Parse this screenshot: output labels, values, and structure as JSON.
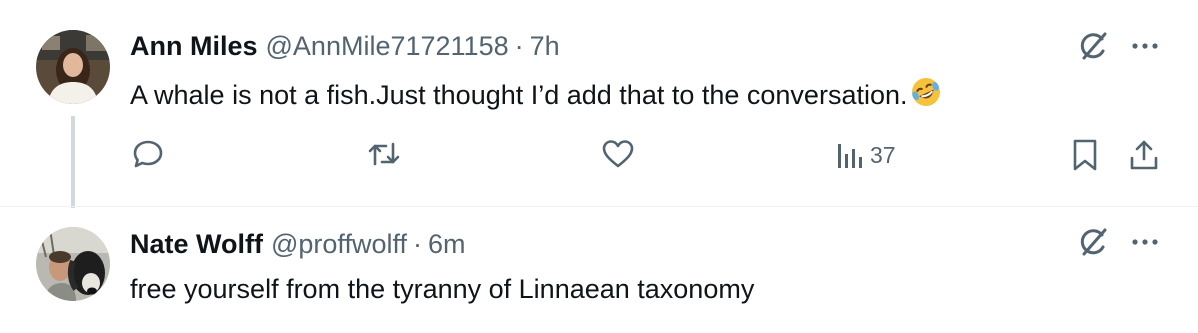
{
  "tweets": [
    {
      "name": "Ann Miles",
      "handle": "@AnnMile71721158",
      "separator": "·",
      "time": "7h",
      "text": "A whale is not a fish.Just thought I’d add that to the conversation.",
      "emoji": "rolling-on-floor-laughing",
      "views": "37"
    },
    {
      "name": "Nate Wolff",
      "handle": "@proffwolff",
      "separator": "·",
      "time": "6m",
      "text": "free yourself from the tyranny of Linnaean taxonomy"
    }
  ],
  "colors": {
    "text": "#0f1419",
    "secondary": "#536471",
    "thread_line": "#cfd9de",
    "emoji": "#f5c33b"
  },
  "icons": [
    "reply-icon",
    "retweet-icon",
    "like-icon",
    "views-icon",
    "bookmark-icon",
    "share-icon",
    "grok-icon",
    "more-icon"
  ]
}
